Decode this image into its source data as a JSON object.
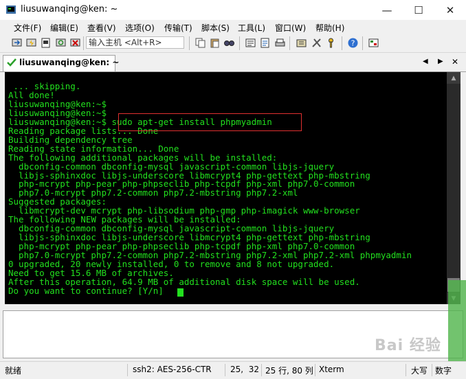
{
  "window": {
    "title": "liusuwanqing@ken: ~",
    "minimize_glyph": "—",
    "maximize_glyph": "☐",
    "close_glyph": "✕"
  },
  "menu": [
    "文件(F)",
    "编辑(E)",
    "查看(V)",
    "选项(O)",
    "传输(T)",
    "脚本(S)",
    "工具(L)",
    "窗口(W)",
    "帮助(H)"
  ],
  "toolbar": {
    "host_placeholder": "输入主机 <Alt+R>"
  },
  "tab": {
    "label": "liusuwanqing@ken: ~",
    "nav_left": "◀",
    "nav_right": "▶",
    "close": "✕"
  },
  "terminal": {
    "text": " ... skipping.\nAll done!\nliusuwanqing@ken:~$\nliusuwanqing@ken:~$\nliusuwanqing@ken:~$ sudo apt-get install phpmyadmin\nReading package lists... Done\nBuilding dependency tree\nReading state information... Done\nThe following additional packages will be installed:\n  dbconfig-common dbconfig-mysql javascript-common libjs-jquery\n  libjs-sphinxdoc libjs-underscore libmcrypt4 php-gettext php-mbstring\n  php-mcrypt php-pear php-phpseclib php-tcpdf php-xml php7.0-common\n  php7.0-mcrypt php7.2-common php7.2-mbstring php7.2-xml\nSuggested packages:\n  libmcrypt-dev mcrypt php-libsodium php-gmp php-imagick www-browser\nThe following NEW packages will be installed:\n  dbconfig-common dbconfig-mysql javascript-common libjs-jquery\n  libjs-sphinxdoc libjs-underscore libmcrypt4 php-gettext php-mbstring\n  php-mcrypt php-pear php-phpseclib php-tcpdf php-xml php7.0-common\n  php7.0-mcrypt php7.2-common php7.2-mbstring php7.2-xml php7.2-xml phpmyadmin\n0 upgraded, 20 newly installed, 0 to remove and 8 not upgraded.\nNeed to get 15.6 MB of archives.\nAfter this operation, 64.9 MB of additional disk space will be used.\nDo you want to continue? [Y/n] ",
    "fg_color": "#22e01e",
    "bg_color": "#000000",
    "highlight_color": "#e03030"
  },
  "status": {
    "state": "就绪",
    "cipher": "ssh2: AES-256-CTR",
    "cursor_pos": "25,  32",
    "size": "25 行, 80 列",
    "term_type": "Xterm",
    "caps": "大写",
    "num": "数字"
  },
  "watermark": "Bai 经验"
}
